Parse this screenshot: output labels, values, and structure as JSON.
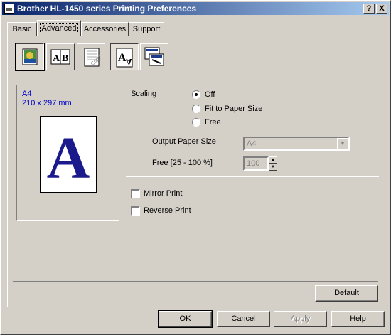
{
  "window": {
    "title": "Brother HL-1450 series Printing Preferences",
    "help_btn": "?",
    "close_btn": "X"
  },
  "tabs": [
    {
      "label": "Basic"
    },
    {
      "label": "Advanced"
    },
    {
      "label": "Accessories"
    },
    {
      "label": "Support"
    }
  ],
  "toolbar": {
    "icons": [
      "print-quality-icon",
      "duplex-icon",
      "watermark-icon",
      "device-options-icon",
      "other-options-icon"
    ]
  },
  "preview": {
    "paper_name": "A4",
    "paper_dims": "210 x 297 mm",
    "page_letter": "A"
  },
  "scaling": {
    "label": "Scaling",
    "options": [
      "Off",
      "Fit to Paper Size",
      "Free"
    ],
    "selected": "Off",
    "output_paper_label": "Output Paper Size",
    "output_paper_value": "A4",
    "free_label": "Free [25 - 100 %]",
    "free_value": "100"
  },
  "print_options": {
    "mirror_label": "Mirror Print",
    "reverse_label": "Reverse Print"
  },
  "buttons": {
    "default": "Default",
    "ok": "OK",
    "cancel": "Cancel",
    "apply": "Apply",
    "help": "Help"
  }
}
